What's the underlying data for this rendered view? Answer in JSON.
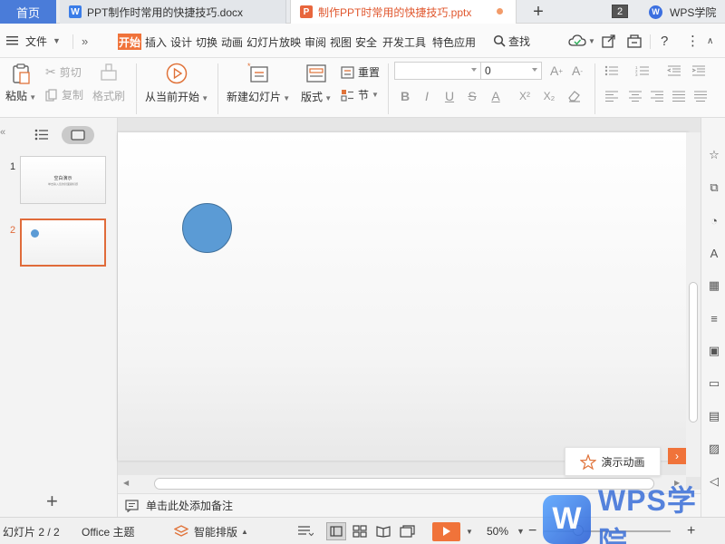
{
  "tabs": {
    "home": "首页",
    "doc": "PPT制作时常用的快捷技巧.docx",
    "ppt": "制作PPT时常用的快捷技巧.pptx",
    "add": "+",
    "window_count": "2",
    "academy": "WPS学院"
  },
  "menu": {
    "file": "文件",
    "expand": "»",
    "tabs": [
      "开始",
      "插入",
      "设计",
      "切换",
      "动画",
      "幻灯片放映",
      "审阅",
      "视图",
      "安全",
      "开发工具",
      "特色应用"
    ],
    "search": "查找"
  },
  "ribbon": {
    "paste": "粘贴",
    "cut": "剪切",
    "copy": "复制",
    "format_painter": "格式刷",
    "from_current": "从当前开始",
    "new_slide": "新建幻灯片",
    "layout": "版式",
    "reset": "重置",
    "section": "节",
    "font_name": "",
    "font_size": "0",
    "format_buttons": [
      "B",
      "I",
      "U",
      "S",
      "A",
      "X²",
      "X₂"
    ]
  },
  "slides": {
    "items": [
      {
        "num": "1",
        "title": "空白演示",
        "subtitle": "单击输入您的封面副标题"
      },
      {
        "num": "2"
      }
    ],
    "add": "+"
  },
  "canvas": {
    "animation_button": "演示动画",
    "notes_placeholder": "单击此处添加备注"
  },
  "status": {
    "slide_count": "幻灯片 2 / 2",
    "theme": "Office 主题",
    "smart_layout": "智能排版",
    "zoom": "50%"
  },
  "watermark": {
    "text": "WPS学院"
  },
  "colors": {
    "accent": "#f0733a",
    "brand_blue": "#4a7cd9",
    "shape_fill": "#5b9bd5"
  }
}
